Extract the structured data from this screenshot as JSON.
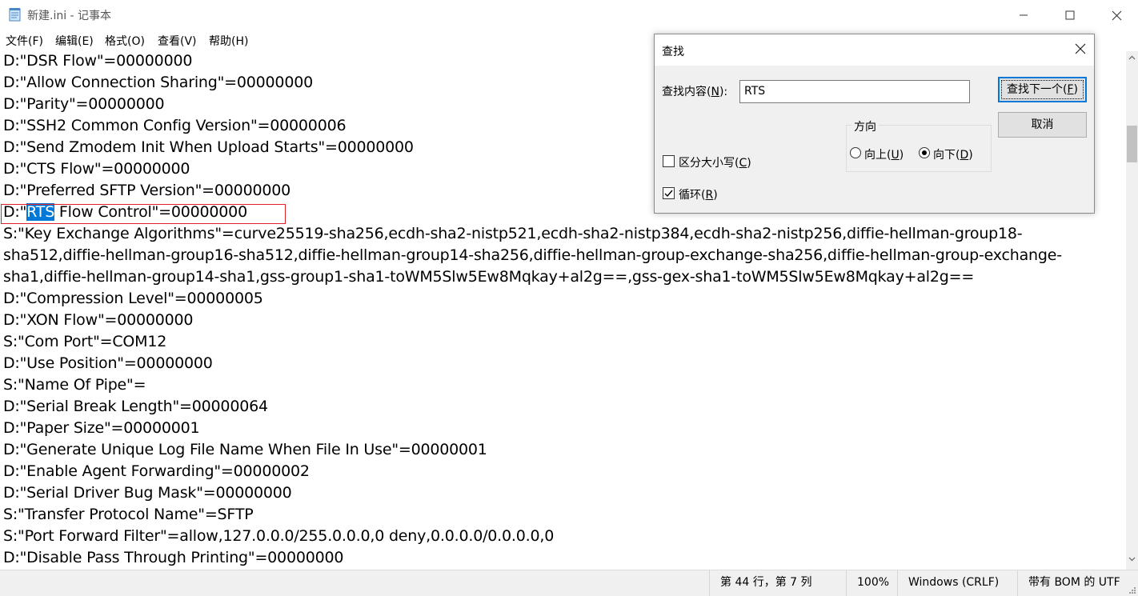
{
  "window": {
    "title": "新建.ini - 记事本"
  },
  "menu": {
    "items": [
      "文件(F)",
      "编辑(E)",
      "格式(O)",
      "查看(V)",
      "帮助(H)"
    ]
  },
  "editor": {
    "lines": [
      "D:\"DSR Flow\"=00000000",
      "D:\"Allow Connection Sharing\"=00000000",
      "D:\"Parity\"=00000000",
      "D:\"SSH2 Common Config Version\"=00000006",
      "D:\"Send Zmodem Init When Upload Starts\"=00000000",
      "D:\"CTS Flow\"=00000000",
      "D:\"Preferred SFTP Version\"=00000000",
      "",
      "S:\"Key Exchange Algorithms\"=curve25519-sha256,ecdh-sha2-nistp521,ecdh-sha2-nistp384,ecdh-sha2-nistp256,diffie-hellman-group18-",
      "sha512,diffie-hellman-group16-sha512,diffie-hellman-group14-sha256,diffie-hellman-group-exchange-sha256,diffie-hellman-group-exchange-",
      "sha1,diffie-hellman-group14-sha1,gss-group1-sha1-toWM5Slw5Ew8Mqkay+al2g==,gss-gex-sha1-toWM5Slw5Ew8Mqkay+al2g==",
      "D:\"Compression Level\"=00000005",
      "D:\"XON Flow\"=00000000",
      "S:\"Com Port\"=COM12",
      "D:\"Use Position\"=00000000",
      "S:\"Name Of Pipe\"=",
      "D:\"Serial Break Length\"=00000064",
      "D:\"Paper Size\"=00000001",
      "D:\"Generate Unique Log File Name When File In Use\"=00000001",
      "D:\"Enable Agent Forwarding\"=00000002",
      "D:\"Serial Driver Bug Mask\"=00000000",
      "S:\"Transfer Protocol Name\"=SFTP",
      "S:\"Port Forward Filter\"=allow,127.0.0.0/255.0.0.0,0 deny,0.0.0.0/0.0.0.0,0",
      "D:\"Disable Pass Through Printing\"=00000000"
    ],
    "highlight_line": {
      "prefix": "D:\"",
      "match": "RTS",
      "suffix": " Flow Control\"=00000000"
    }
  },
  "status": {
    "position": "第 44 行，第 7 列",
    "zoom": "100%",
    "line_ending": "Windows (CRLF)",
    "encoding": "带有 BOM 的 UTF"
  },
  "find_dialog": {
    "title": "查找",
    "find_label": "查找内容(",
    "find_label_key": "N",
    "find_label_end": "):",
    "find_value": "RTS",
    "find_next_label": "查找下一个(",
    "find_next_key": "F",
    "cancel_label": "取消",
    "direction_label": "方向",
    "up_label": "向上(",
    "up_key": "U",
    "down_label": "向下(",
    "down_key": "D",
    "match_case_label": "区分大小写(",
    "match_case_key": "C",
    "wrap_label": "循环(",
    "wrap_key": "R",
    "close_paren": ")"
  },
  "colors": {
    "selection": "#0078d7",
    "search_box_outline": "#e0212c",
    "dialog_bg": "#f0f0f0"
  }
}
